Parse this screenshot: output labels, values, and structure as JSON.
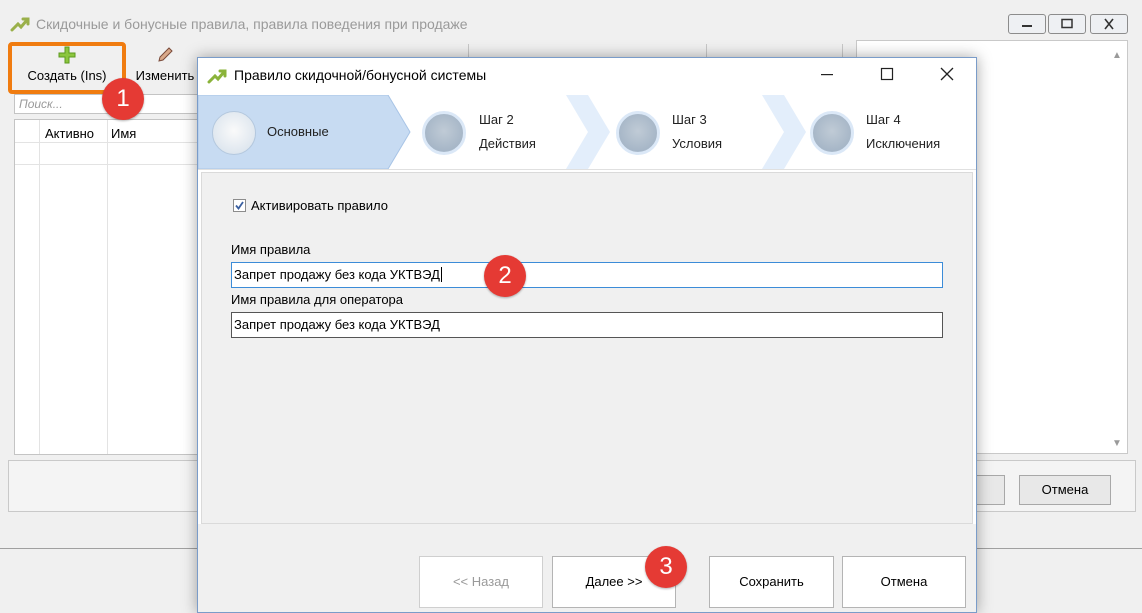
{
  "parent_window": {
    "title": "Скидочные и бонусные правила, правила поведения при продаже",
    "toolbar": {
      "create_label": "Создать (Ins)",
      "edit_label": "Изменить"
    },
    "search_placeholder": "Поиск...",
    "grid_columns": [
      "Активно",
      "Имя"
    ],
    "cancel_label": "Отмена"
  },
  "dialog": {
    "title": "Правило скидочной/бонусной системы",
    "steps": [
      {
        "line1": "",
        "line2": "Основные"
      },
      {
        "line1": "Шаг 2",
        "line2": "Действия"
      },
      {
        "line1": "Шаг 3",
        "line2": "Условия"
      },
      {
        "line1": "Шаг 4",
        "line2": "Исключения"
      }
    ],
    "activate_label": "Активировать правило",
    "activate_checked": true,
    "rule_name_label": "Имя правила",
    "rule_name_value": "Запрет продажу без кода УКТВЭД",
    "operator_name_label": "Имя правила для оператора",
    "operator_name_value": "Запрет продажу без кода УКТВЭД",
    "buttons": {
      "back": "<< Назад",
      "next": "Далее >>",
      "save": "Сохранить",
      "cancel": "Отмена"
    }
  },
  "annotations": [
    "1",
    "2",
    "3"
  ],
  "colors": {
    "highlight": "#f07c10",
    "badge": "#e53a34",
    "active_step": "#c7dbf2",
    "input_focus": "#3c8cd8"
  }
}
